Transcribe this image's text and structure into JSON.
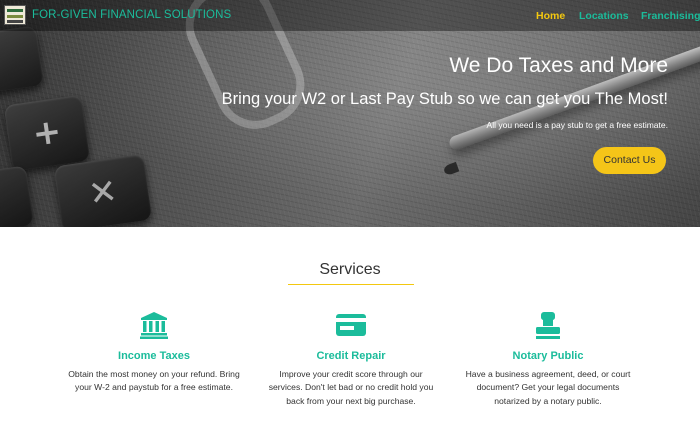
{
  "colors": {
    "accent": "#1bbc9b",
    "active": "#f3c80f",
    "button": "#f5c518"
  },
  "navbar": {
    "brand": "FOR-GIVEN FINANCIAL SOLUTIONS",
    "items": [
      {
        "label": "Home",
        "active": true
      },
      {
        "label": "Locations",
        "active": false
      },
      {
        "label": "Franchising",
        "active": false
      }
    ]
  },
  "hero": {
    "title": "We Do Taxes and More",
    "subtitle": "Bring your W2 or Last Pay Stub so we can get you The Most!",
    "note": "All you need is a pay stub to get a free estimate.",
    "button": "Contact Us"
  },
  "services": {
    "heading": "Services",
    "items": [
      {
        "icon": "bank-icon",
        "title": "Income Taxes",
        "text": "Obtain the most money on your refund. Bring your W-2 and paystub for a free estimate."
      },
      {
        "icon": "credit-card-icon",
        "title": "Credit Repair",
        "text": "Improve your credit score through our services. Don't let bad or no credit hold you back from your next big purchase."
      },
      {
        "icon": "stamp-icon",
        "title": "Notary Public",
        "text": "Have a business agreement, deed, or court document? Get your legal documents notarized by a notary public."
      }
    ]
  }
}
